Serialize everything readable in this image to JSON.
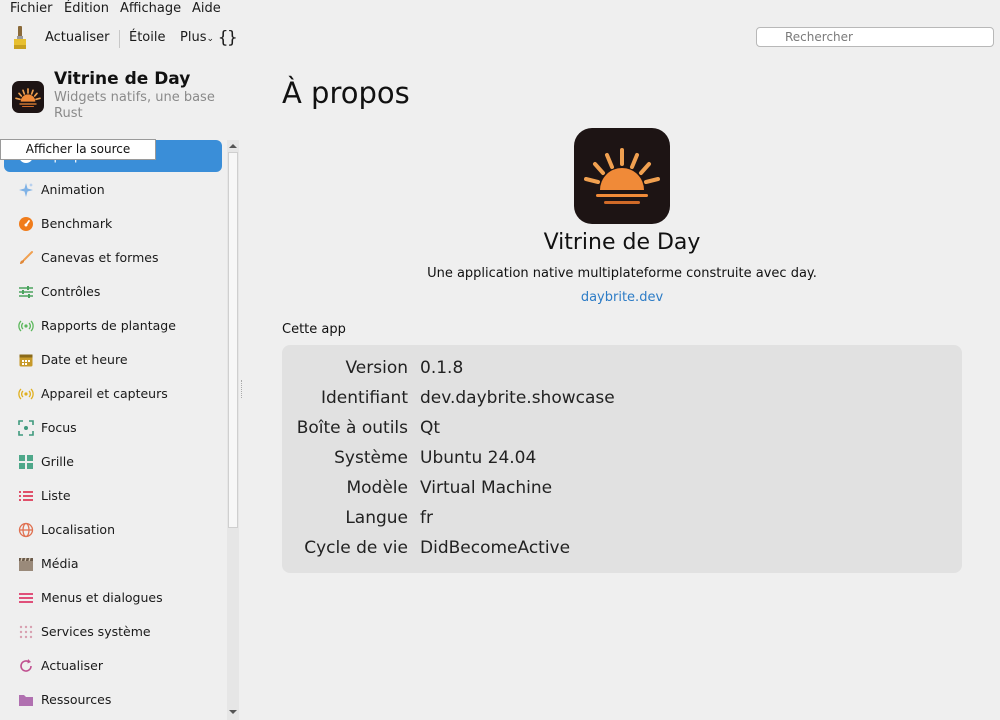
{
  "menubar": {
    "items": [
      "Fichier",
      "Édition",
      "Affichage",
      "Aide"
    ]
  },
  "toolbar": {
    "refresh_label": "Actualiser",
    "star_label": "Étoile",
    "more_label": "Plus",
    "more_caret": "⌄",
    "source_glyph": "{}",
    "search_placeholder": "Rechercher"
  },
  "sidebar": {
    "title": "Vitrine de Day",
    "subtitle": "Widgets natifs, une base Rust",
    "tooltip": "Afficher la source",
    "items": [
      {
        "label": "À propos",
        "icon": "info-icon",
        "active": true
      },
      {
        "label": "Animation",
        "icon": "sparkles-icon",
        "color": "#7fb2e6"
      },
      {
        "label": "Benchmark",
        "icon": "gauge-icon",
        "color": "#f07c1b"
      },
      {
        "label": "Canevas et formes",
        "icon": "brush-icon",
        "color": "#f0a050"
      },
      {
        "label": "Contrôles",
        "icon": "sliders-icon",
        "color": "#4aa35e"
      },
      {
        "label": "Rapports de plantage",
        "icon": "signal-icon",
        "color": "#5cb85c"
      },
      {
        "label": "Date et heure",
        "icon": "calendar-icon",
        "color": "#c79a2a"
      },
      {
        "label": "Appareil et capteurs",
        "icon": "broadcast-icon",
        "color": "#e0b020"
      },
      {
        "label": "Focus",
        "icon": "focus-icon",
        "color": "#3f9a7e"
      },
      {
        "label": "Grille",
        "icon": "grid-icon",
        "color": "#4ea88a"
      },
      {
        "label": "Liste",
        "icon": "list-icon",
        "color": "#e0506a"
      },
      {
        "label": "Localisation",
        "icon": "globe-icon",
        "color": "#e07050"
      },
      {
        "label": "Média",
        "icon": "clapper-icon",
        "color": "#9a8a7a"
      },
      {
        "label": "Menus et dialogues",
        "icon": "menu-icon",
        "color": "#e0507a"
      },
      {
        "label": "Services système",
        "icon": "dots-grid-icon",
        "color": "#d8a0b0"
      },
      {
        "label": "Actualiser",
        "icon": "refresh-icon",
        "color": "#c05090"
      },
      {
        "label": "Ressources",
        "icon": "folder-icon",
        "color": "#b070b0"
      }
    ]
  },
  "main": {
    "title": "À propos",
    "app_name": "Vitrine de Day",
    "app_description": "Une application native multiplateforme construite avec day.",
    "app_link": "daybrite.dev",
    "section_label": "Cette app",
    "info": [
      {
        "key": "Version",
        "value": "0.1.8"
      },
      {
        "key": "Identifiant",
        "value": "dev.daybrite.showcase"
      },
      {
        "key": "Boîte à outils",
        "value": "Qt"
      },
      {
        "key": "Système",
        "value": "Ubuntu 24.04"
      },
      {
        "key": "Modèle",
        "value": "Virtual Machine"
      },
      {
        "key": "Langue",
        "value": "fr"
      },
      {
        "key": "Cycle de vie",
        "value": "DidBecomeActive"
      }
    ]
  },
  "colors": {
    "accent": "#3a8ed8",
    "link": "#2d7cc6",
    "sun": "#f0a050",
    "icon_bg": "#1d1414"
  }
}
